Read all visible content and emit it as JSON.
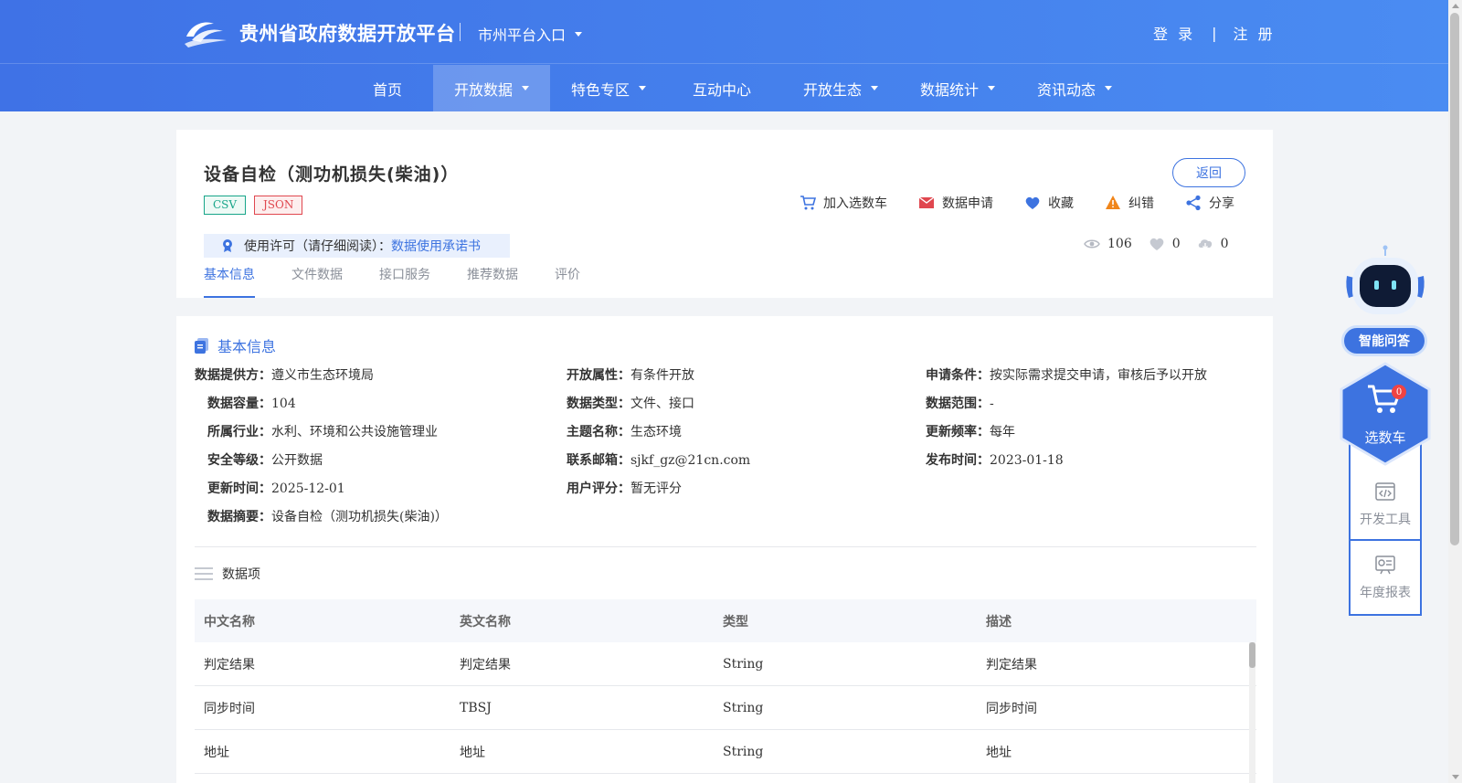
{
  "header": {
    "site_title": "贵州省政府数据开放平台",
    "city_entry": "市州平台入口",
    "login": "登 录",
    "separator": "|",
    "register": "注 册"
  },
  "nav": [
    {
      "label": "首页"
    },
    {
      "label": "开放数据"
    },
    {
      "label": "特色专区"
    },
    {
      "label": "互动中心"
    },
    {
      "label": "开放生态"
    },
    {
      "label": "数据统计"
    },
    {
      "label": "资讯动态"
    }
  ],
  "dataset": {
    "title": "设备自检（测功机损失(柴油)）",
    "formats": [
      "CSV",
      "JSON"
    ],
    "back": "返回",
    "actions": [
      "加入选数车",
      "数据申请",
      "收藏",
      "纠错",
      "分享"
    ],
    "license_label": "使用许可（请仔细阅读）：",
    "license_link": "数据使用承诺书",
    "views": "106",
    "likes": "0",
    "downloads": "0",
    "tabs": [
      "基本信息",
      "文件数据",
      "接口服务",
      "推荐数据",
      "评价"
    ]
  },
  "basic_info": {
    "section_title": "基本信息",
    "fields": [
      {
        "key": "数据提供方：",
        "value": "遵义市生态环境局"
      },
      {
        "key": "开放属性：",
        "value": "有条件开放"
      },
      {
        "key": "申请条件：",
        "value": "按实际需求提交申请，审核后予以开放"
      },
      {
        "key": "数据容量：",
        "value": "104"
      },
      {
        "key": "数据类型：",
        "value": "文件、接口"
      },
      {
        "key": "数据范围：",
        "value": "-"
      },
      {
        "key": "所属行业：",
        "value": "水利、环境和公共设施管理业"
      },
      {
        "key": "主题名称：",
        "value": "生态环境"
      },
      {
        "key": "更新频率：",
        "value": "每年"
      },
      {
        "key": "安全等级：",
        "value": "公开数据"
      },
      {
        "key": "联系邮箱：",
        "value": "sjkf_gz@21cn.com"
      },
      {
        "key": "发布时间：",
        "value": "2023-01-18"
      },
      {
        "key": "更新时间：",
        "value": "2025-12-01"
      },
      {
        "key": "用户评分：",
        "value": "暂无评分"
      },
      {
        "key": "数据摘要：",
        "value": "设备自检（测功机损失(柴油)）"
      }
    ]
  },
  "data_items": {
    "title": "数据项",
    "columns": [
      "中文名称",
      "英文名称",
      "类型",
      "描述"
    ],
    "rows": [
      [
        "判定结果",
        "判定结果",
        "String",
        "判定结果"
      ],
      [
        "同步时间",
        "TBSJ",
        "String",
        "同步时间"
      ],
      [
        "地址",
        "地址",
        "String",
        "地址"
      ]
    ]
  },
  "side": {
    "ai_label": "智能问答",
    "cart_label": "选数车",
    "cart_count": "0",
    "dev_tools": "开发工具",
    "annual_report": "年度报表"
  },
  "colors": {
    "brand_blue": "#3d73e0",
    "header_start": "#3f72e6",
    "header_end": "#4a8cf2",
    "csv_green": "#17a589",
    "json_red": "#e0474f"
  }
}
